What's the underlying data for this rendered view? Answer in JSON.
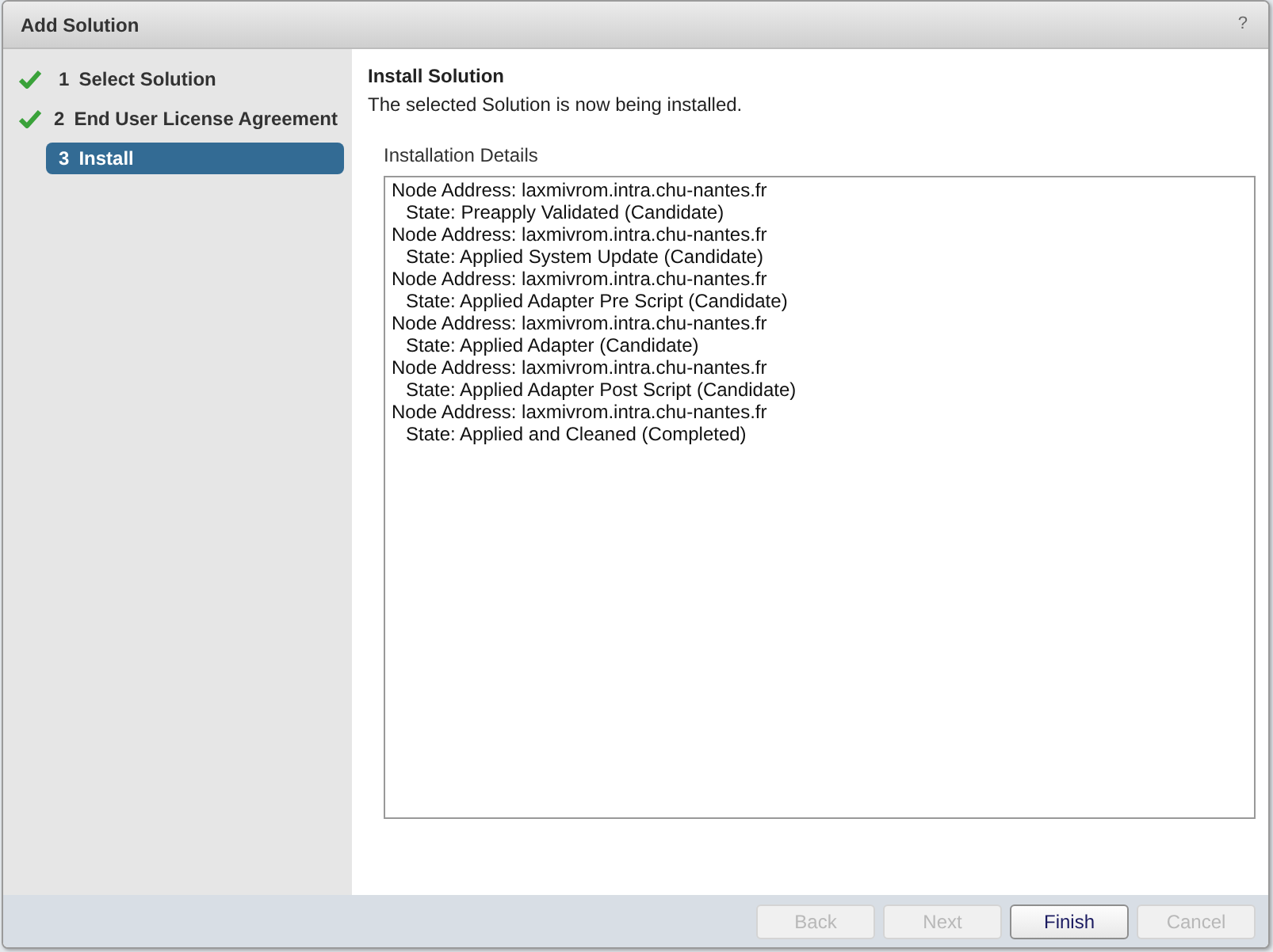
{
  "window": {
    "title": "Add Solution",
    "help": "?"
  },
  "steps": [
    {
      "number": "1",
      "label": "Select Solution",
      "completed": true,
      "selected": false
    },
    {
      "number": "2",
      "label": "End User License Agreement",
      "completed": true,
      "selected": false
    },
    {
      "number": "3",
      "label": "Install",
      "completed": false,
      "selected": true
    }
  ],
  "page": {
    "title": "Install Solution",
    "description": "The selected Solution is now being installed."
  },
  "details": {
    "label": "Installation Details",
    "lines": [
      {
        "kind": "node",
        "text": "Node Address: laxmivrom.intra.chu-nantes.fr"
      },
      {
        "kind": "state",
        "text": "State: Preapply Validated (Candidate)"
      },
      {
        "kind": "node",
        "text": "Node Address: laxmivrom.intra.chu-nantes.fr"
      },
      {
        "kind": "state",
        "text": "State: Applied System Update (Candidate)"
      },
      {
        "kind": "node",
        "text": "Node Address: laxmivrom.intra.chu-nantes.fr"
      },
      {
        "kind": "state",
        "text": "State: Applied Adapter Pre Script (Candidate)"
      },
      {
        "kind": "node",
        "text": "Node Address: laxmivrom.intra.chu-nantes.fr"
      },
      {
        "kind": "state",
        "text": "State: Applied Adapter (Candidate)"
      },
      {
        "kind": "node",
        "text": "Node Address: laxmivrom.intra.chu-nantes.fr"
      },
      {
        "kind": "state",
        "text": "State: Applied Adapter Post Script (Candidate)"
      },
      {
        "kind": "node",
        "text": "Node Address: laxmivrom.intra.chu-nantes.fr"
      },
      {
        "kind": "state",
        "text": "State: Applied and Cleaned (Completed)"
      }
    ]
  },
  "buttons": [
    {
      "label": "Back",
      "disabled": true
    },
    {
      "label": "Next",
      "disabled": true
    },
    {
      "label": "Finish",
      "disabled": false
    },
    {
      "label": "Cancel",
      "disabled": true
    }
  ]
}
